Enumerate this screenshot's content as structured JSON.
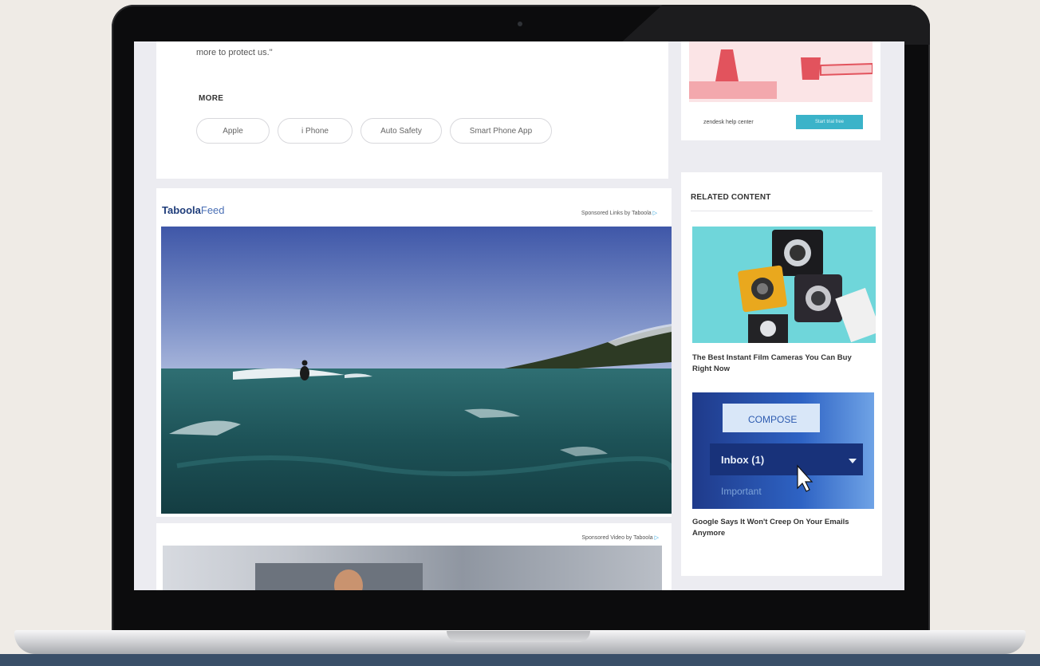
{
  "article": {
    "quote_fragment": "more to protect us.\"",
    "more_heading": "MORE",
    "tags": [
      "Apple",
      "i Phone",
      "Auto Safety",
      "Smart Phone App"
    ]
  },
  "feed": {
    "logo_main": "Taboola",
    "logo_sub": "Feed",
    "sponsored_links_label": "Sponsored Links by Taboola",
    "sponsored_video_label": "Sponsored Video by Taboola"
  },
  "sidebar_ad": {
    "text": "zendesk help center",
    "button_label": "Start trial free"
  },
  "related": {
    "heading": "RELATED CONTENT",
    "items": [
      {
        "title": "The Best Instant Film Cameras You Can Buy Right Now"
      },
      {
        "title": "Google Says It Won't Creep On Your Emails Anymore"
      }
    ],
    "compose_label": "COMPOSE",
    "inbox_label": "Inbox (1)",
    "important_label": "Important"
  },
  "colors": {
    "taboola_blue": "#1f3d7a",
    "ad_button": "#3bb3c9",
    "ad_accent": "#e2535d"
  },
  "icons": [
    "play-triangle-icon",
    "play-triangle-icon"
  ]
}
